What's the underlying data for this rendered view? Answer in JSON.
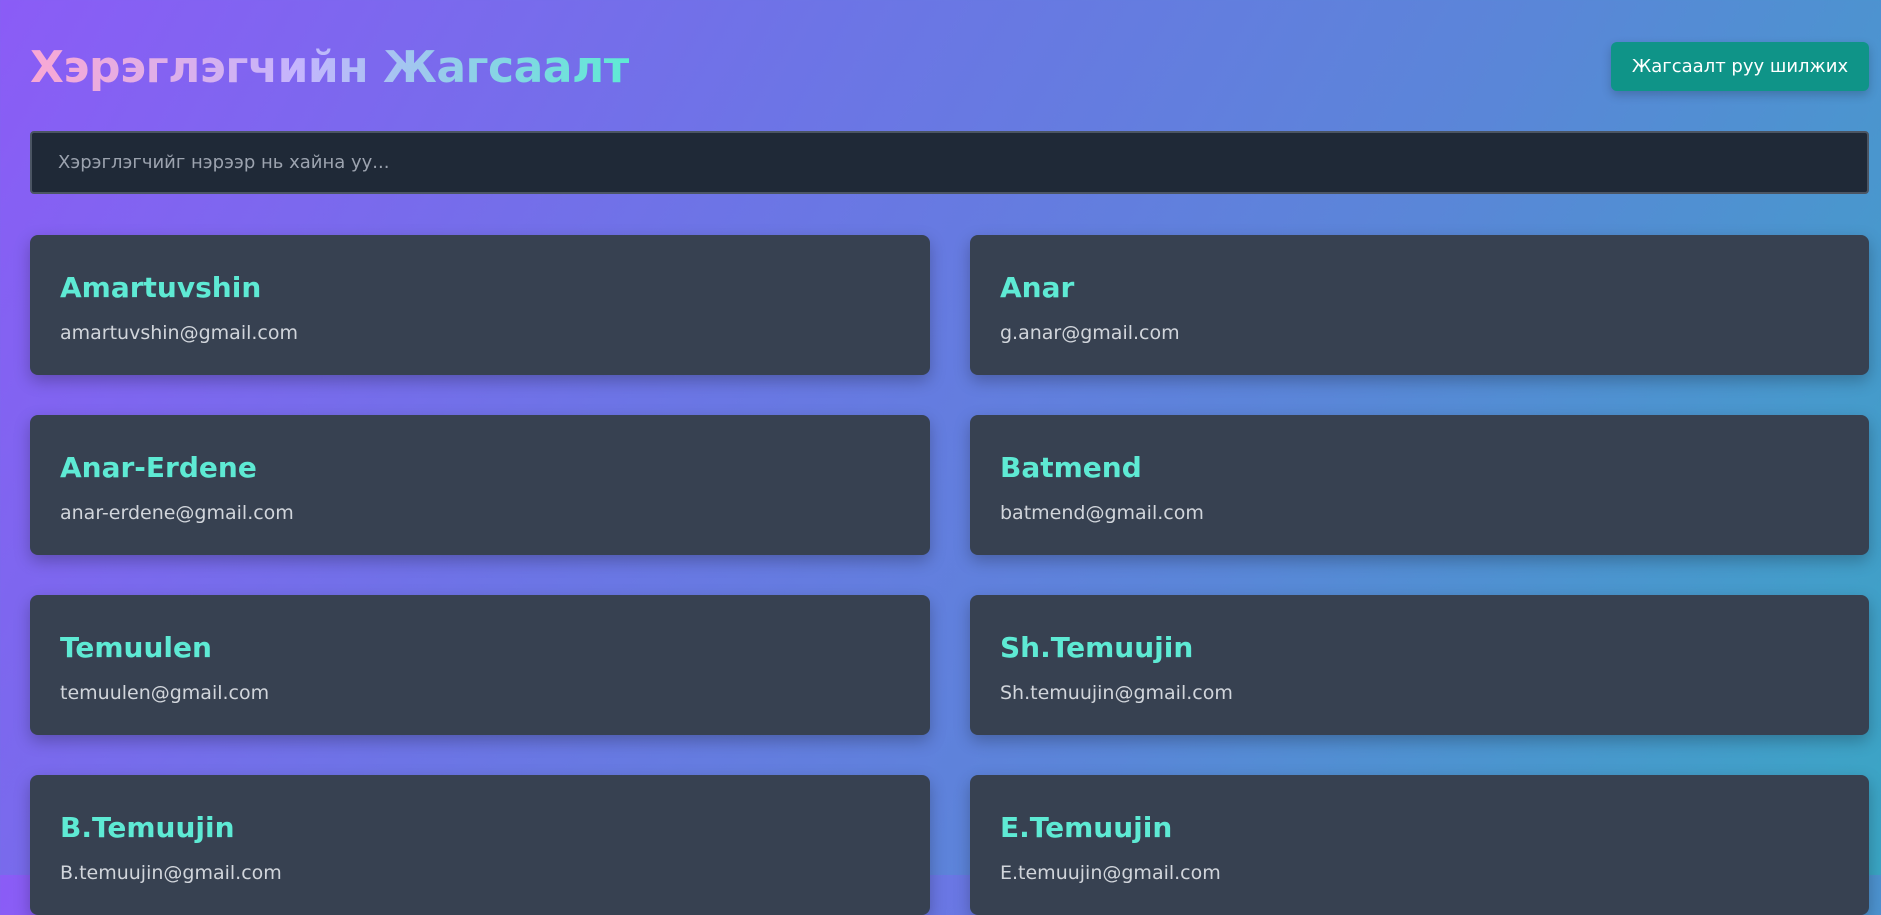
{
  "header": {
    "title": "Хэрэглэгчийн Жагсаалт",
    "switch_button_label": "Жагсаалт руу шилжих"
  },
  "search": {
    "placeholder": "Хэрэглэгчийг нэрээр нь хайна уу...",
    "value": ""
  },
  "users": [
    {
      "name": "Amartuvshin",
      "email": "amartuvshin@gmail.com"
    },
    {
      "name": "Anar",
      "email": "g.anar@gmail.com"
    },
    {
      "name": "Anar-Erdene",
      "email": "anar-erdene@gmail.com"
    },
    {
      "name": "Batmend",
      "email": "batmend@gmail.com"
    },
    {
      "name": "Temuulen",
      "email": "temuulen@gmail.com"
    },
    {
      "name": "Sh.Temuujin",
      "email": "Sh.temuujin@gmail.com"
    },
    {
      "name": "B.Temuujin",
      "email": "B.temuujin@gmail.com"
    },
    {
      "name": "E.Temuujin",
      "email": "E.temuujin@gmail.com"
    }
  ],
  "colors": {
    "accent": "#5eead4",
    "button": "#0f9488",
    "card": "#374151",
    "search_bg": "#1f2937"
  }
}
